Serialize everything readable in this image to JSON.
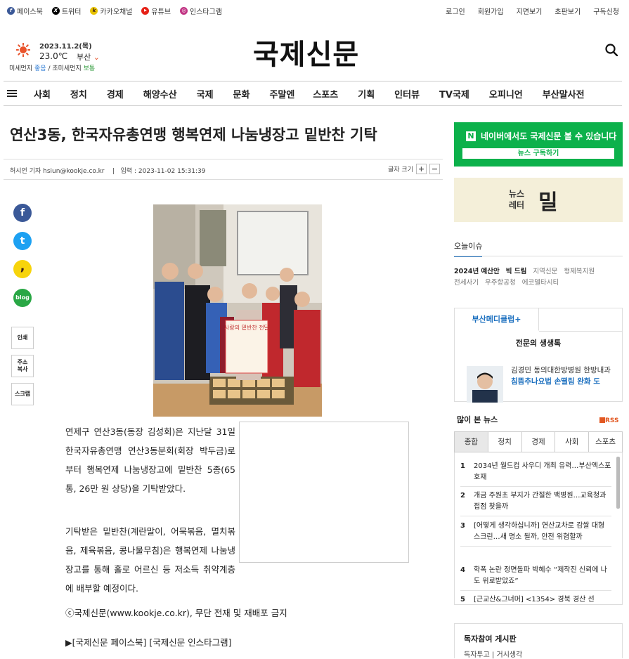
{
  "social": [
    {
      "name": "facebook",
      "label": "페이스북",
      "color": "#3b5998",
      "glyph": "f"
    },
    {
      "name": "twitter",
      "label": "트위터",
      "color": "#000000",
      "glyph": "X"
    },
    {
      "name": "kakao",
      "label": "카카오채널",
      "color": "#e7c200",
      "glyph": "k"
    },
    {
      "name": "youtube",
      "label": "유튜브",
      "color": "#e62117",
      "glyph": "▶"
    },
    {
      "name": "instagram",
      "label": "인스타그램",
      "color": "#c13584",
      "glyph": "◎"
    }
  ],
  "toplinks": [
    "로그인",
    "회원가입",
    "지면보기",
    "초판보기",
    "구독신청"
  ],
  "weather": {
    "date": "2023.11.2(목)",
    "temp": "23.0℃",
    "city": "부산",
    "dust_label": "미세먼지",
    "dust_value": "좋음",
    "fine_dust_label": "/ 초미세먼지",
    "fine_dust_value": "보통"
  },
  "logo": "국제신문",
  "nav": [
    "사회",
    "정치",
    "경제",
    "해양수산",
    "국제",
    "문화",
    "주말엔",
    "스포츠",
    "기획",
    "인터뷰",
    "TV국제",
    "오피니언",
    "부산말사전"
  ],
  "article": {
    "title": "연산3동, 한국자유총연맹 행복연제 나눔냉장고 밑반찬 기탁",
    "byline": "허시언 기자 hsiun@kookje.co.kr",
    "separator": "|",
    "date": "입력 : 2023-11-02 15:31:39",
    "font_size_label": "글자 크기",
    "plus": "+",
    "minus": "−",
    "para1": "연제구 연산3동(동장 김성회)은 지난달 31일 한국자유총연맹 연산3동분회(회장 박두금)로부터 행복연제 나눔냉장고에 밑반찬 5종(65통, 26만 원 상당)을 기탁받았다.",
    "para2": "기탁받은 밑반찬(계란말이, 어묵볶음, 멸치볶음, 제육볶음, 콩나물무침)은 행복연제 나눔냉장고를 통해 홀로 어르신 등 저소득 취약계층에 배부할 예정이다.",
    "copyright": "ⓒ국제신문(www.kookje.co.kr), 무단 전재 및 재배포 금지",
    "fb_links": "▶[국제신문 페이스북] [국제신문 인스타그램]",
    "banner_text": "사랑의 밑반찬 전달"
  },
  "share": {
    "facebook": "f",
    "twitter": "t",
    "kakao": ",",
    "blog": "blog",
    "print": "인쇄",
    "copy_url": "주소\n복사",
    "scrap": "스크랩"
  },
  "naver": {
    "text": "네이버에서도 국제신문 볼 수 있습니다",
    "button": "뉴스 구독하기",
    "logo": "N"
  },
  "newsletter": {
    "line1": "뉴스",
    "line2": "레터",
    "brand": "밀"
  },
  "issues": {
    "title": "오늘이슈",
    "items": [
      {
        "label": "2024년 예산안",
        "bold": true
      },
      {
        "label": "빅 드림",
        "bold": true
      },
      {
        "label": "지역신문",
        "bold": false
      },
      {
        "label": "형제복지원",
        "bold": false
      },
      {
        "label": "전세사기",
        "bold": false
      },
      {
        "label": "우주항공청",
        "bold": false
      },
      {
        "label": "에코델타시티",
        "bold": false
      }
    ]
  },
  "medi": {
    "tab": "부산메디클럽+",
    "heading": "전문의 생생톡",
    "doctor": "김경민 동의대한방병원 한방내과",
    "topic": "침뜸추나요법 손떨림 완화 도"
  },
  "popular": {
    "title": "많이 본 뉴스",
    "rss": "RSS",
    "tabs": [
      "종합",
      "정치",
      "경제",
      "사회",
      "스포츠"
    ],
    "items": [
      {
        "n": "1",
        "text": "2034년 월드컵 사우디 개최 유력…부산엑스포 호재"
      },
      {
        "n": "2",
        "text": "개금 주원초 부지가 간절한 백병원…교육청과 접점 찾을까"
      },
      {
        "n": "3",
        "text": "[어떻게 생각하십니까] 연산교차로 감쌀 대형 스크린…새 명소 될까, 안전 위협할까"
      },
      {
        "n": "4",
        "text": "학폭 논란 정면돌파 박혜수 “제작진 신뢰에 나도 위로받았죠”"
      },
      {
        "n": "5",
        "text": "[근교산&그너머] <1354> 경북 경산 선"
      }
    ]
  },
  "reader": {
    "title": "독자참여 게시판",
    "sub": "독자투고  |  거시생각"
  }
}
